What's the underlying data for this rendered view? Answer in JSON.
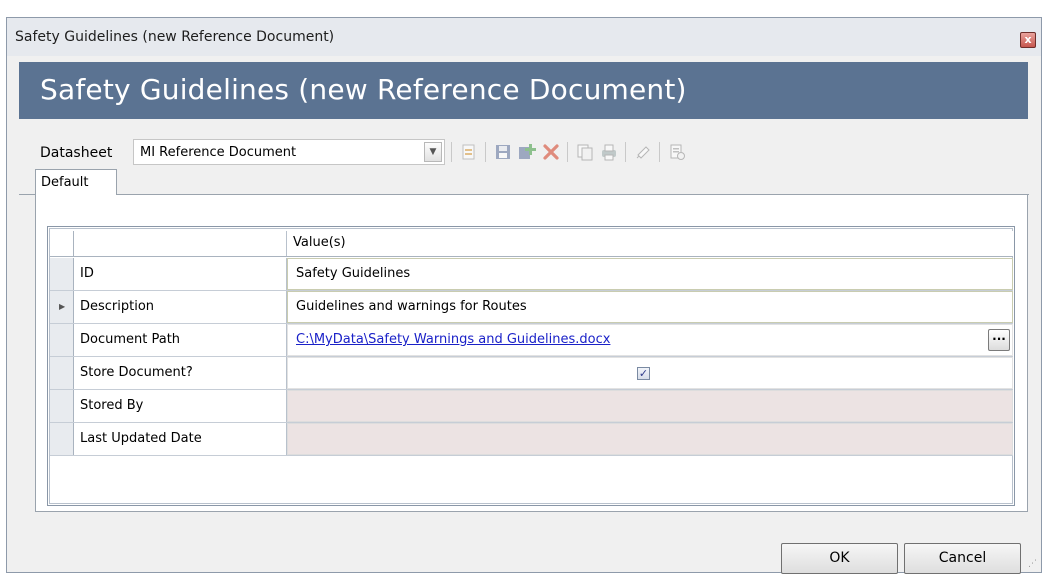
{
  "window": {
    "title": "Safety Guidelines (new Reference Document)",
    "close_label": "x"
  },
  "banner": {
    "title": "Safety Guidelines (new Reference Document)"
  },
  "datasheet": {
    "label": "Datasheet",
    "selected": "MI Reference Document",
    "arrow": "▼"
  },
  "toolbar": {
    "icons": [
      "new-record-icon",
      "save-icon",
      "add-icon",
      "delete-icon",
      "copy-icon",
      "print-icon",
      "link-icon",
      "history-icon"
    ],
    "colors": {
      "save": "#5a6e9a",
      "add": "#3d9a3d",
      "delete": "#d23a1e"
    }
  },
  "tabs": [
    {
      "label": "Default"
    }
  ],
  "grid": {
    "header": {
      "field": "",
      "value": "Value(s)"
    },
    "rows": [
      {
        "field": "ID",
        "value": "Safety Guidelines"
      },
      {
        "field": "Description",
        "value": "Guidelines and warnings for Routes"
      },
      {
        "field": "Document Path",
        "value": "C:\\MyData\\Safety Warnings and Guidelines.docx",
        "button": "···"
      },
      {
        "field": "Store Document?",
        "checked": true,
        "check_mark": "✓"
      },
      {
        "field": "Stored By",
        "value": ""
      },
      {
        "field": "Last Updated Date",
        "value": ""
      }
    ]
  },
  "buttons": {
    "ok": "OK",
    "cancel": "Cancel"
  }
}
